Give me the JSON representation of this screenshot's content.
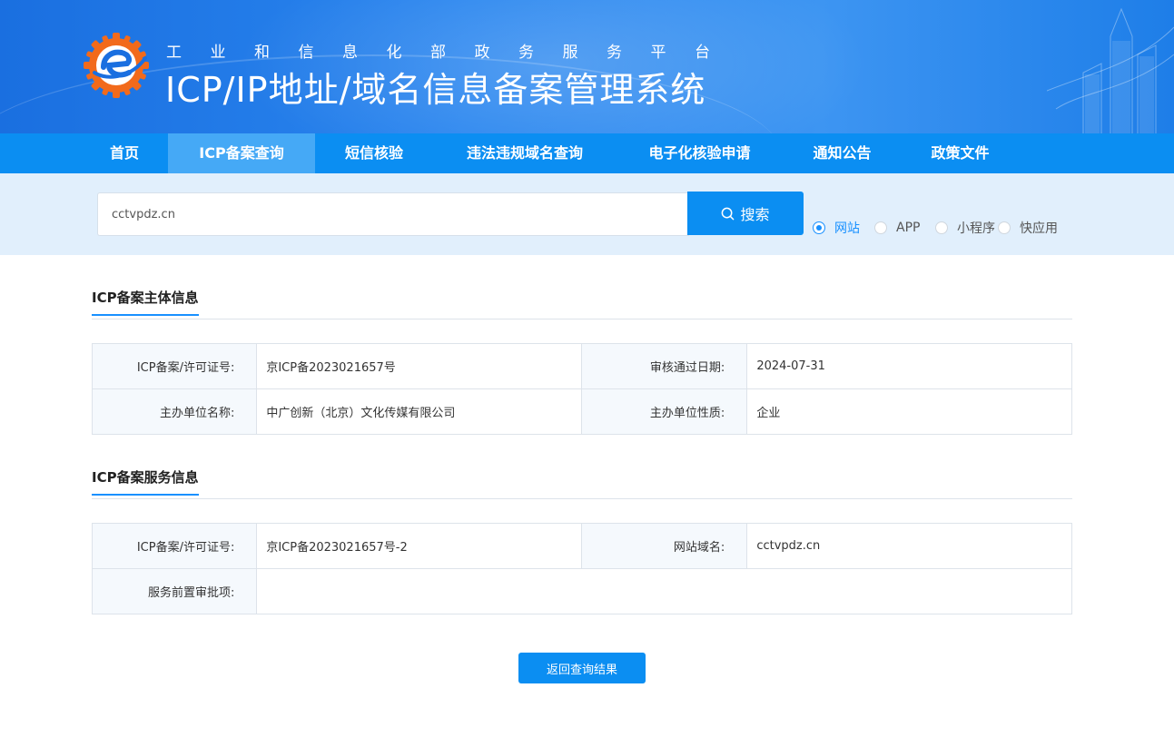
{
  "header": {
    "subtitle": "工业和信息化部政务服务平台",
    "title": "ICP/IP地址/域名信息备案管理系统"
  },
  "nav": {
    "items": [
      {
        "label": "首页"
      },
      {
        "label": "ICP备案查询",
        "active": true
      },
      {
        "label": "短信核验"
      },
      {
        "label": "违法违规域名查询"
      },
      {
        "label": "电子化核验申请"
      },
      {
        "label": "通知公告"
      },
      {
        "label": "政策文件"
      }
    ]
  },
  "search": {
    "value": "cctvpdz.cn",
    "button_label": "搜索",
    "button_icon": "search-icon",
    "options": [
      {
        "label": "网站",
        "checked": true
      },
      {
        "label": "APP",
        "checked": false
      },
      {
        "label": "小程序",
        "checked": false
      },
      {
        "label": "快应用",
        "checked": false
      }
    ]
  },
  "subject": {
    "title": "ICP备案主体信息",
    "license_label": "ICP备案/许可证号:",
    "license_value": "京ICP备2023021657号",
    "approve_date_label": "审核通过日期:",
    "approve_date_value": "2024-07-31",
    "org_name_label": "主办单位名称:",
    "org_name_value": "中广创新（北京）文化传媒有限公司",
    "org_type_label": "主办单位性质:",
    "org_type_value": "企业"
  },
  "service": {
    "title": "ICP备案服务信息",
    "license_label": "ICP备案/许可证号:",
    "license_value": "京ICP备2023021657号-2",
    "domain_label": "网站域名:",
    "domain_value": "cctvpdz.cn",
    "preapproval_label": "服务前置审批项:",
    "preapproval_value": ""
  },
  "back_button_label": "返回查询结果",
  "colors": {
    "primary": "#0b8ef2",
    "nav_active": "#45a9f6",
    "search_band": "#e1effc",
    "radio_checked": "#1890ff"
  }
}
